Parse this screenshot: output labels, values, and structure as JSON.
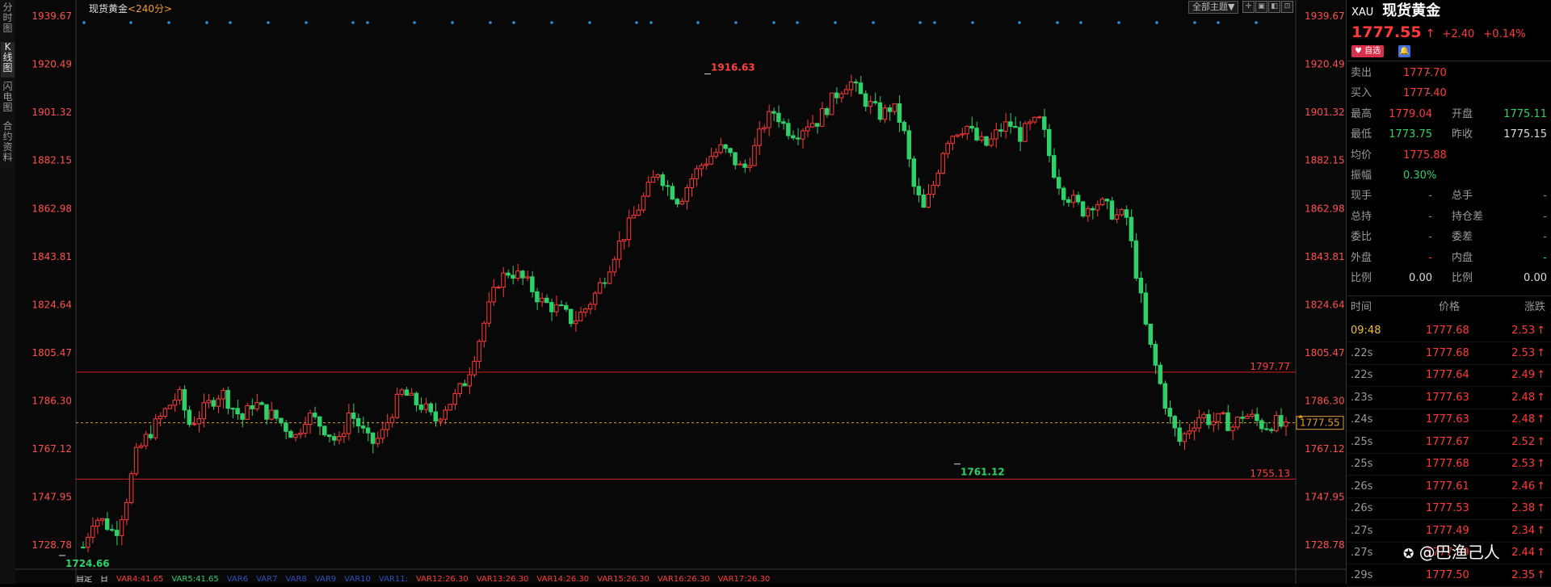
{
  "sidebar": {
    "tabs": [
      {
        "label": "分时图",
        "active": false
      },
      {
        "label": "K线图",
        "active": true
      },
      {
        "label": "闪电图",
        "active": false
      },
      {
        "label": "合约资料",
        "active": false
      }
    ]
  },
  "chart": {
    "title": "现货黄金",
    "period": "<240分>",
    "theme_button": "全部主题▼",
    "current_price_tag": "1777.55",
    "high_marker": "1916.63",
    "low_marker": "1724.66",
    "recent_low_marker": "1761.12",
    "resistance_label": "1797.77",
    "support_label": "1755.13",
    "indicators": [
      {
        "text": "自定",
        "color": "#dcdcdc"
      },
      {
        "text": "日",
        "color": "#dcdcdc"
      },
      {
        "text": "VAR4:41.65",
        "color": "#ff3b3b"
      },
      {
        "text": "VAR5:41.65",
        "color": "#2ed06a"
      },
      {
        "text": "VAR6",
        "color": "#3050c0"
      },
      {
        "text": "VAR7",
        "color": "#3050c0"
      },
      {
        "text": "VAR8",
        "color": "#3050c0"
      },
      {
        "text": "VAR9",
        "color": "#3050c0"
      },
      {
        "text": "VAR10",
        "color": "#3050c0"
      },
      {
        "text": "VAR11:",
        "color": "#3050c0"
      },
      {
        "text": "VAR12:26.30",
        "color": "#ff3b3b"
      },
      {
        "text": "VAR13:26.30",
        "color": "#ff3b3b"
      },
      {
        "text": "VAR14:26.30",
        "color": "#ff3b3b"
      },
      {
        "text": "VAR15:26.30",
        "color": "#ff3b3b"
      },
      {
        "text": "VAR16:26.30",
        "color": "#ff3b3b"
      },
      {
        "text": "VAR17:26.30",
        "color": "#ff3b3b"
      }
    ]
  },
  "chart_data": {
    "type": "candlestick",
    "title": "现货黄金 <240分>",
    "ylim": [
      1719.19,
      1939.67
    ],
    "y_ticks": [
      "1939.67",
      "1920.49",
      "1901.32",
      "1882.15",
      "1862.98",
      "1843.81",
      "1824.64",
      "1805.47",
      "1786.30",
      "1767.12",
      "1747.95",
      "1728.78"
    ],
    "horizontal_lines": [
      {
        "value": 1797.77,
        "color": "#cc2020",
        "style": "solid"
      },
      {
        "value": 1755.13,
        "color": "#cc2020",
        "style": "solid"
      },
      {
        "value": 1777.55,
        "color": "#e0a030",
        "style": "dashed"
      }
    ],
    "trend_path": [
      1728,
      1740,
      1738,
      1733,
      1746,
      1765,
      1772,
      1778,
      1784,
      1789,
      1777,
      1781,
      1786,
      1790,
      1784,
      1779,
      1786,
      1782,
      1780,
      1776,
      1772,
      1781,
      1778,
      1774,
      1769,
      1782,
      1776,
      1769,
      1772,
      1782,
      1790,
      1786,
      1784,
      1778,
      1784,
      1788,
      1795,
      1808,
      1822,
      1834,
      1838,
      1836,
      1832,
      1826,
      1824,
      1822,
      1818,
      1822,
      1828,
      1836,
      1846,
      1854,
      1862,
      1870,
      1878,
      1871,
      1866,
      1874,
      1880,
      1884,
      1887,
      1883,
      1878,
      1886,
      1897,
      1902,
      1895,
      1893,
      1897,
      1898,
      1904,
      1910,
      1914,
      1908,
      1904,
      1900,
      1904,
      1896,
      1872,
      1862,
      1874,
      1890,
      1894,
      1896,
      1890,
      1888,
      1894,
      1897,
      1892,
      1896,
      1898,
      1880,
      1870,
      1866,
      1862,
      1866,
      1864,
      1860,
      1860,
      1836,
      1812,
      1796,
      1780,
      1770,
      1776,
      1781,
      1778,
      1779,
      1776,
      1781,
      1779,
      1776,
      1778,
      1775
    ]
  },
  "quote": {
    "symbol": "XAU",
    "name": "现货黄金",
    "price": "1777.55",
    "arrow": "↑",
    "change": "+2.40",
    "change_pct": "+0.14%",
    "selfselect_button": "自选",
    "fields": [
      {
        "l1": "卖出",
        "v1": "1777.70",
        "c1": "red",
        "l2": "",
        "v2": "-",
        "c2": "gray"
      },
      {
        "l1": "买入",
        "v1": "1777.40",
        "c1": "red",
        "l2": "",
        "v2": "-",
        "c2": "gray"
      },
      {
        "l1": "最高",
        "v1": "1779.04",
        "c1": "red",
        "l2": "开盘",
        "v2": "1775.11",
        "c2": "green"
      },
      {
        "l1": "最低",
        "v1": "1773.75",
        "c1": "green",
        "l2": "昨收",
        "v2": "1775.15",
        "c2": "white"
      },
      {
        "l1": "均价",
        "v1": "1775.88",
        "c1": "red",
        "l2": "",
        "v2": "",
        "c2": "gray"
      },
      {
        "l1": "振幅",
        "v1": "0.30%",
        "c1": "green",
        "l2": "",
        "v2": "",
        "c2": "gray"
      },
      {
        "l1": "现手",
        "v1": "-",
        "c1": "gray",
        "l2": "总手",
        "v2": "-",
        "c2": "gray"
      },
      {
        "l1": "总持",
        "v1": "-",
        "c1": "gray",
        "l2": "持仓差",
        "v2": "-",
        "c2": "gray"
      },
      {
        "l1": "委比",
        "v1": "-",
        "c1": "gray",
        "l2": "委差",
        "v2": "-",
        "c2": "gray"
      },
      {
        "l1": "外盘",
        "v1": "-",
        "c1": "red",
        "l2": "内盘",
        "v2": "-",
        "c2": "green"
      },
      {
        "l1": "比例",
        "v1": "0.00",
        "c1": "white",
        "l2": "比例",
        "v2": "0.00",
        "c2": "white"
      }
    ],
    "ticks_header": {
      "time": "时间",
      "price": "价格",
      "change": "涨跌"
    },
    "ticks": [
      {
        "time": "09:48",
        "price": "1777.68",
        "change": "2.53"
      },
      {
        "time": ".22s",
        "price": "1777.68",
        "change": "2.53"
      },
      {
        "time": ".22s",
        "price": "1777.64",
        "change": "2.49"
      },
      {
        "time": ".23s",
        "price": "1777.63",
        "change": "2.48"
      },
      {
        "time": ".24s",
        "price": "1777.63",
        "change": "2.48"
      },
      {
        "time": ".25s",
        "price": "1777.67",
        "change": "2.52"
      },
      {
        "time": ".25s",
        "price": "1777.68",
        "change": "2.53"
      },
      {
        "time": ".26s",
        "price": "1777.61",
        "change": "2.46"
      },
      {
        "time": ".26s",
        "price": "1777.53",
        "change": "2.38"
      },
      {
        "time": ".27s",
        "price": "1777.49",
        "change": "2.34"
      },
      {
        "time": ".27s",
        "price": "1777.59",
        "change": "2.44"
      },
      {
        "time": ".29s",
        "price": "1777.50",
        "change": "2.35"
      }
    ],
    "tick_arrow": "↑",
    "watermark": "@巴渔己人"
  },
  "colors": {
    "up": "#ff3b3b",
    "down": "#2ed06a",
    "grid": "#1c1c1c",
    "dots": "#2a8fd8",
    "marker_text": "#ff4040"
  }
}
